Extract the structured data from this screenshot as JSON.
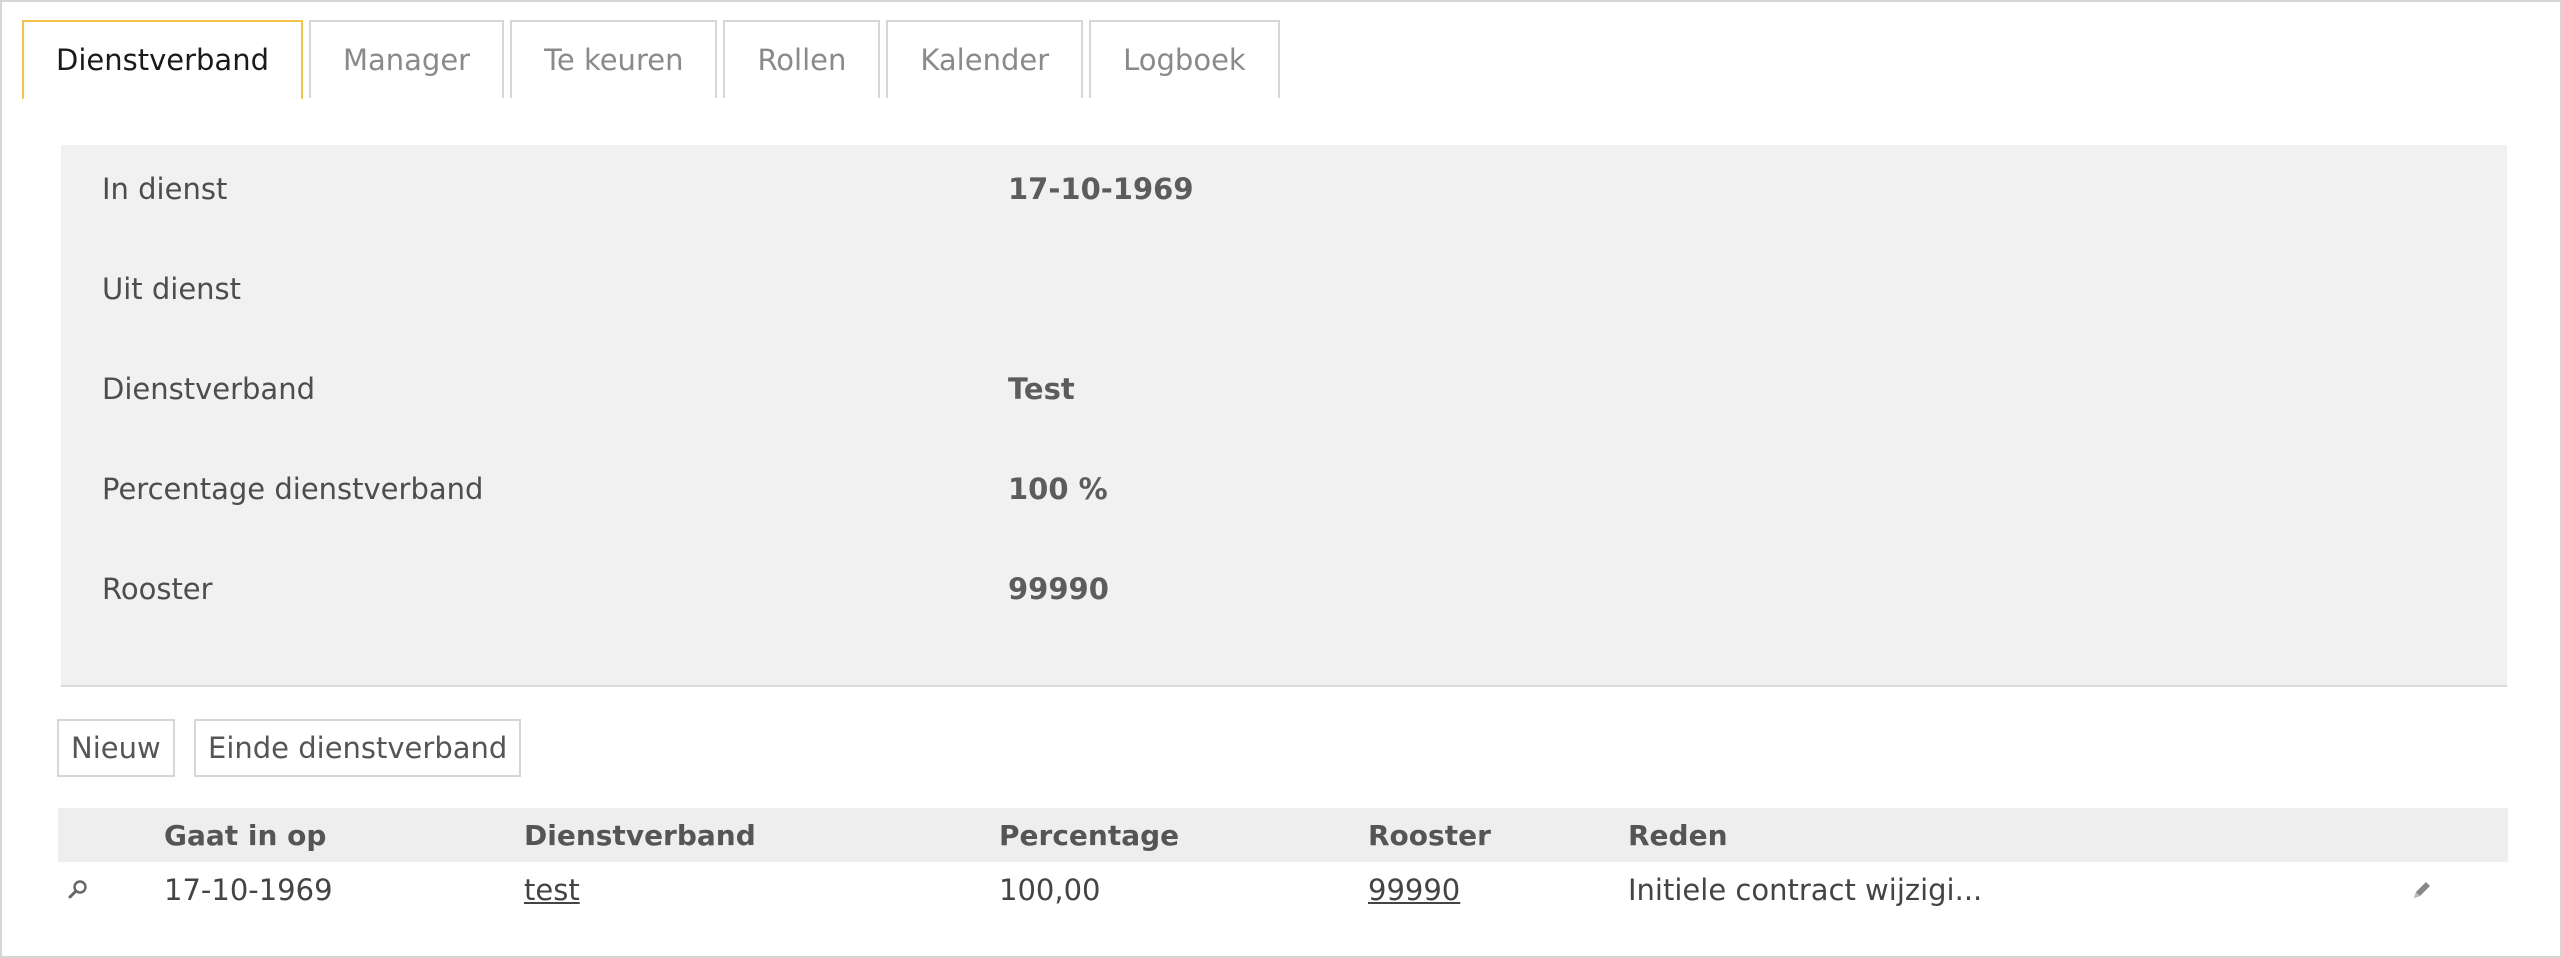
{
  "tabs": [
    {
      "label": "Dienstverband",
      "active": true
    },
    {
      "label": "Manager",
      "active": false
    },
    {
      "label": "Te keuren",
      "active": false
    },
    {
      "label": "Rollen",
      "active": false
    },
    {
      "label": "Kalender",
      "active": false
    },
    {
      "label": "Logboek",
      "active": false
    }
  ],
  "info": {
    "rows": [
      {
        "label": "In dienst",
        "value": "17-10-1969"
      },
      {
        "label": "Uit dienst",
        "value": ""
      },
      {
        "label": "Dienstverband",
        "value": "Test"
      },
      {
        "label": "Percentage dienstverband",
        "value": "100 %"
      },
      {
        "label": "Rooster",
        "value": "99990"
      }
    ]
  },
  "actions": {
    "new_label": "Nieuw",
    "end_label": "Einde dienstverband"
  },
  "table": {
    "columns": [
      "Gaat in op",
      "Dienstverband",
      "Percentage",
      "Rooster",
      "Reden"
    ],
    "rows": [
      {
        "gaat_in_op": "17-10-1969",
        "dienstverband": "test",
        "percentage": "100,00",
        "rooster": "99990",
        "reden": "Initiele contract wijzigi..."
      }
    ]
  },
  "icons": {
    "view": "magnifier-icon",
    "edit": "pencil-icon"
  },
  "colors": {
    "active_tab_border": "#f3c24a",
    "panel_bg": "#f1f1f1",
    "header_bg": "#eeeeee"
  }
}
